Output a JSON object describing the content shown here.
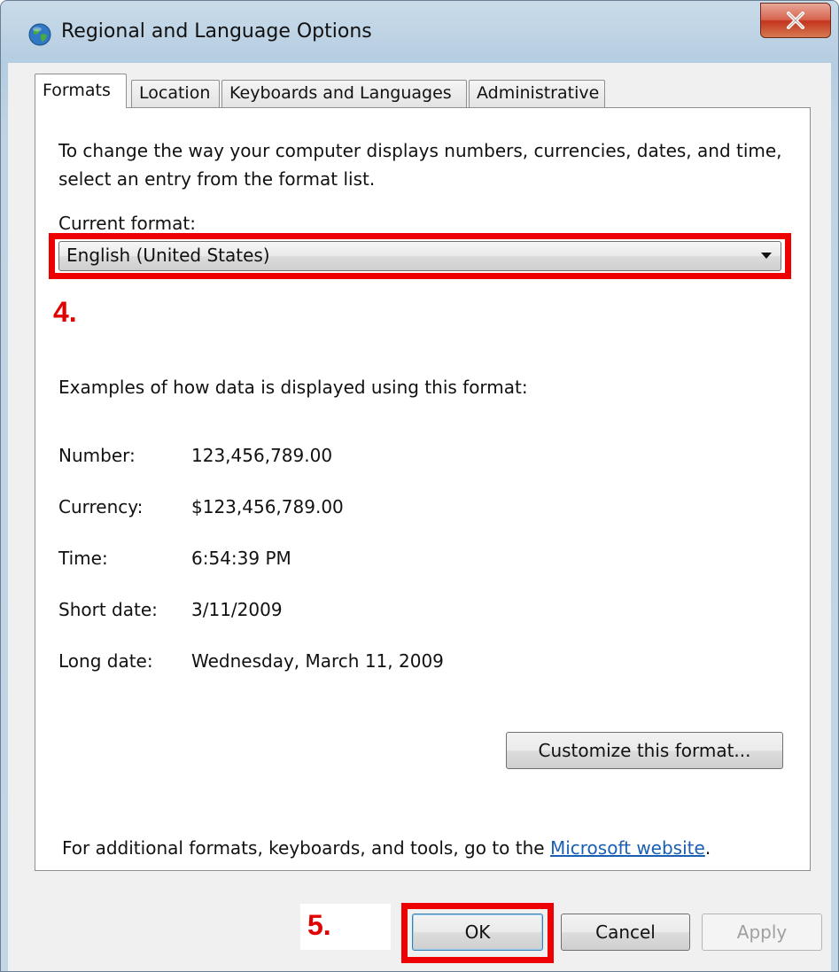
{
  "window": {
    "title": "Regional and Language Options",
    "icon": "globe-icon",
    "close_icon": "close-icon"
  },
  "tabs": [
    {
      "label": "Formats",
      "active": true
    },
    {
      "label": "Location",
      "active": false
    },
    {
      "label": "Keyboards and Languages",
      "active": false
    },
    {
      "label": "Administrative",
      "active": false
    }
  ],
  "formats": {
    "intro": "To change the way your computer displays numbers, currencies, dates, and time, select an entry from the format list.",
    "current_format_label": "Current format:",
    "current_format_value": "English (United States)",
    "examples_heading": "Examples of how data is displayed using this format:",
    "examples": [
      {
        "label": "Number:",
        "value": "123,456,789.00"
      },
      {
        "label": "Currency:",
        "value": "$123,456,789.00"
      },
      {
        "label": "Time:",
        "value": "6:54:39 PM"
      },
      {
        "label": "Short date:",
        "value": "3/11/2009"
      },
      {
        "label": "Long date:",
        "value": "Wednesday, March 11, 2009"
      }
    ],
    "customize_button": "Customize this format...",
    "footer_text": "For additional formats, keyboards, and tools, go to the ",
    "footer_link": "Microsoft website",
    "footer_end": "."
  },
  "buttons": {
    "ok": "OK",
    "cancel": "Cancel",
    "apply": "Apply"
  },
  "annotations": {
    "step4": "4.",
    "step5": "5.",
    "highlight_color": "#ee0000"
  }
}
